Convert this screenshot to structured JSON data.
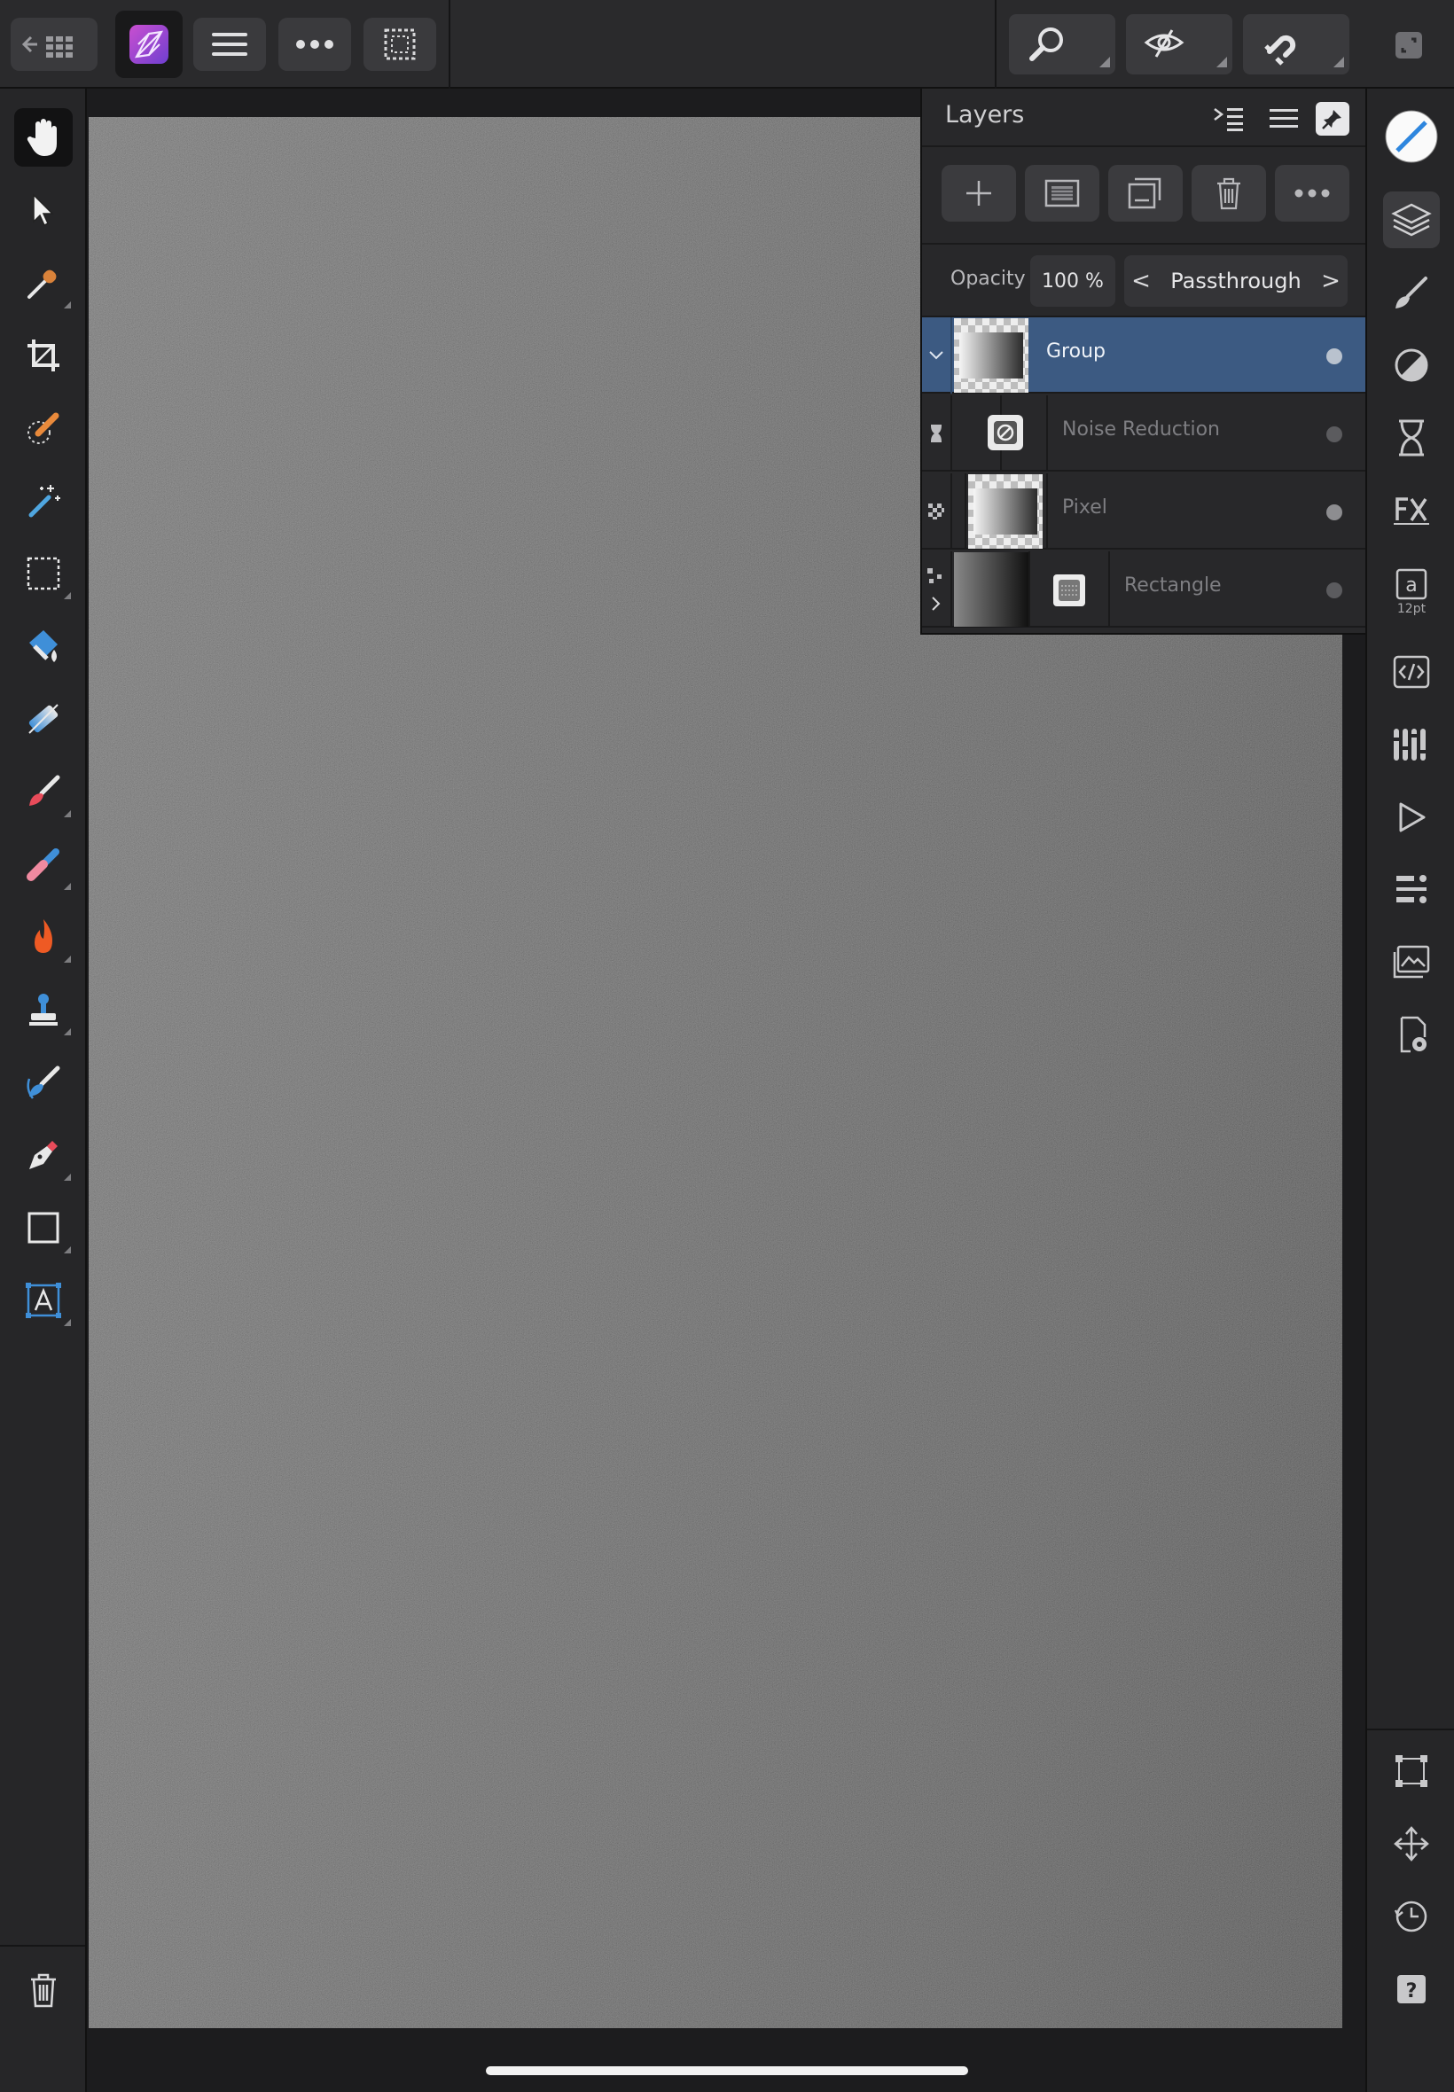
{
  "topbar": {
    "back_icon": "back-to-gallery-icon",
    "app_icon": "affinity-photo-icon",
    "menu_icon": "hamburger-icon",
    "more_icon": "more-icon",
    "selection_icon": "selection-icon",
    "zoom_icon": "zoom-icon",
    "view_icon": "view-mode-icon",
    "snapping_icon": "snapping-icon",
    "fullscreen_icon": "fullscreen-icon"
  },
  "tools": [
    {
      "name": "view-tool",
      "active": true
    },
    {
      "name": "move-tool"
    },
    {
      "name": "color-picker-tool"
    },
    {
      "name": "crop-tool"
    },
    {
      "name": "selection-brush-tool"
    },
    {
      "name": "flood-select-tool"
    },
    {
      "name": "marquee-tool"
    },
    {
      "name": "flood-fill-tool"
    },
    {
      "name": "gradient-tool"
    },
    {
      "name": "paint-brush-tool"
    },
    {
      "name": "erase-brush-tool"
    },
    {
      "name": "dodge-burn-tool"
    },
    {
      "name": "clone-tool"
    },
    {
      "name": "smudge-tool"
    },
    {
      "name": "pen-tool"
    },
    {
      "name": "rectangle-tool"
    },
    {
      "name": "artistic-text-tool"
    },
    {
      "name": "delete-tool"
    }
  ],
  "layers_panel": {
    "title": "Layers",
    "opacity_label": "Opacity",
    "opacity_value": "100 %",
    "blend_mode": "Passthrough",
    "blend_prev": "<",
    "blend_next": ">",
    "layers": [
      {
        "name": "Group",
        "selected": true,
        "visible": true
      },
      {
        "name": "Noise Reduction",
        "selected": false,
        "visible": false
      },
      {
        "name": "Pixel",
        "selected": false,
        "visible": true
      },
      {
        "name": "Rectangle",
        "selected": false,
        "visible": false
      }
    ]
  },
  "studio": {
    "text_style_size": "12pt",
    "items": [
      "color",
      "layers",
      "brushes",
      "adjustments",
      "history-hourglass",
      "fx",
      "text-style",
      "transform-code",
      "channels",
      "macro-play",
      "navigator",
      "stock",
      "document-settings",
      "transform",
      "move",
      "history",
      "help"
    ]
  }
}
